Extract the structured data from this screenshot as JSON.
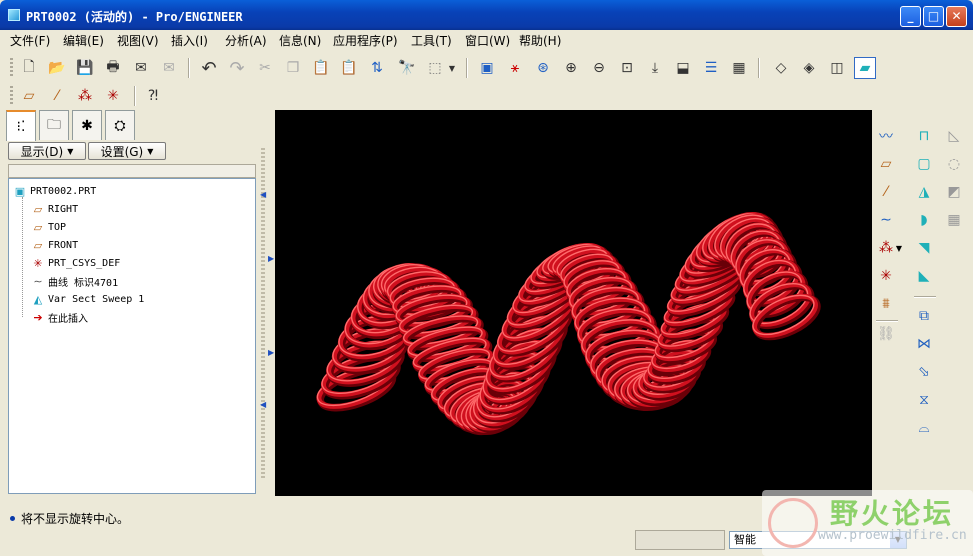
{
  "window": {
    "title": "PRT0002 (活动的) - Pro/ENGINEER",
    "minimize": "_",
    "maximize": "□",
    "close": "✕"
  },
  "menu": [
    "文件(F)",
    "编辑(E)",
    "视图(V)",
    "插入(I)",
    "分析(A)",
    "信息(N)",
    "应用程序(P)",
    "工具(T)",
    "窗口(W)",
    "帮助(H)"
  ],
  "toolbar": {
    "icons": {
      "new": "new-file-icon",
      "open": "open-folder-icon",
      "save": "save-icon",
      "print": "print-icon",
      "undo": "undo-icon",
      "redo": "redo-icon",
      "cut": "cut-icon",
      "copy": "copy-icon",
      "paste": "paste-icon",
      "regen": "regenerate-icon",
      "find": "find-icon",
      "select": "select-box-icon",
      "repaint": "repaint-icon",
      "spin": "spin-center-icon",
      "orient": "orient-icon",
      "zoom_in": "zoom-in-icon",
      "zoom_out": "zoom-out-icon",
      "refit": "refit-icon",
      "wireframe": "wireframe-icon",
      "hidden": "hidden-line-icon",
      "no_hidden": "no-hidden-icon",
      "shaded": "shaded-icon"
    }
  },
  "navigator": {
    "show_label": "显示(D)",
    "settings_label": "设置(G)",
    "tree": [
      {
        "label": "PRT0002.PRT",
        "icon": "part-icon"
      },
      {
        "label": "RIGHT",
        "icon": "datum-plane-icon"
      },
      {
        "label": "TOP",
        "icon": "datum-plane-icon"
      },
      {
        "label": "FRONT",
        "icon": "datum-plane-icon"
      },
      {
        "label": "PRT_CSYS_DEF",
        "icon": "csys-icon"
      },
      {
        "label": "曲线 标识4701",
        "icon": "curve-icon"
      },
      {
        "label": "Var Sect Sweep 1",
        "icon": "sweep-icon"
      },
      {
        "label": "在此插入",
        "icon": "insert-here-icon"
      }
    ]
  },
  "model": {
    "color": "#d0101e",
    "highlight": "#ff6b6b",
    "shadow": "#6a0008",
    "background": "#000000"
  },
  "status": {
    "message": "将不显示旋转中心。",
    "filter": "智能"
  },
  "watermark": {
    "title": "野火论坛",
    "url": "www.proewildfire.cn"
  }
}
